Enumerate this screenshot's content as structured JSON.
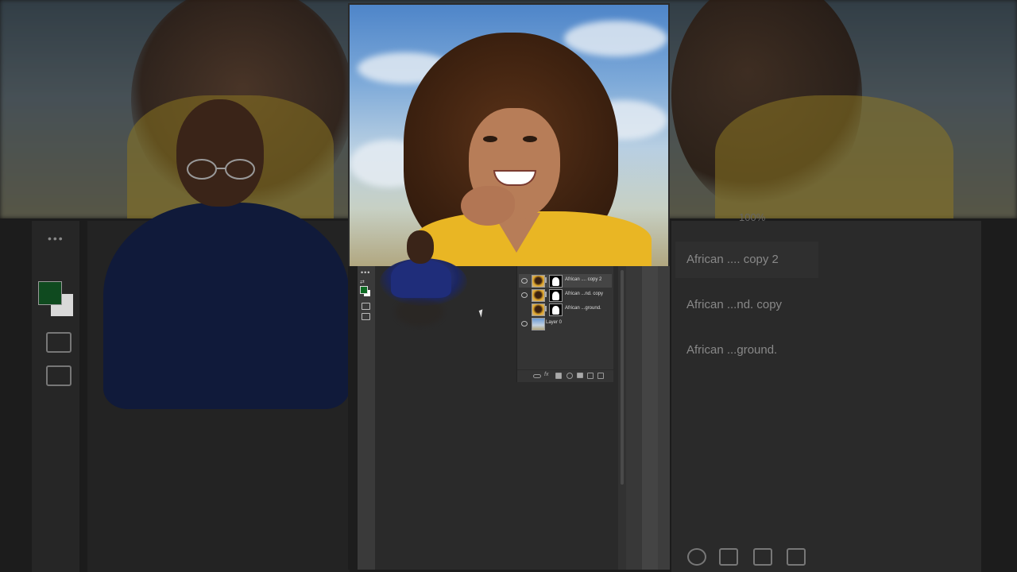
{
  "layers_panel": {
    "layers": [
      {
        "name": "African .... copy 2",
        "visible": true,
        "selected": true,
        "has_mask": true
      },
      {
        "name": "African ...nd. copy",
        "visible": true,
        "selected": false,
        "has_mask": true
      },
      {
        "name": "African ...ground.",
        "visible": false,
        "selected": false,
        "has_mask": true
      },
      {
        "name": "Layer 0",
        "visible": true,
        "selected": false,
        "has_mask": false
      }
    ],
    "bottom_fx_label": "fx"
  },
  "background_zoom": {
    "layers": [
      {
        "name": "African .... copy 2"
      },
      {
        "name": "African ...nd. copy"
      },
      {
        "name": "African ...ground."
      }
    ],
    "zoom_text": "100%"
  },
  "toolbar": {
    "foreground_color": "#0d6b23",
    "background_color": "#ffffff"
  },
  "colors": {
    "shirt": "#e9b624",
    "presenter_shirt": "#1f2d7a",
    "panel_bg": "#343434"
  }
}
